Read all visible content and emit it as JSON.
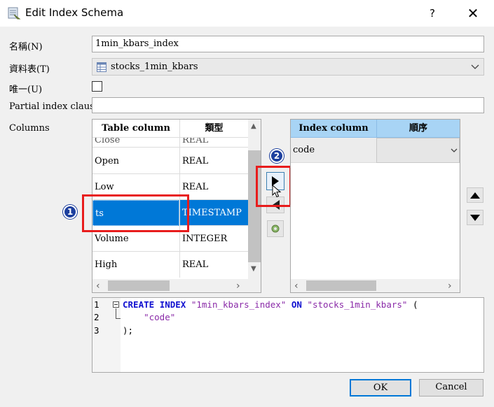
{
  "window": {
    "title": "Edit Index Schema",
    "help": "?",
    "close": "✕"
  },
  "form": {
    "name_label": "名稱(N)",
    "name_value": "1min_kbars_index",
    "table_label": "資料表(T)",
    "table_value": "stocks_1min_kbars",
    "unique_label": "唯一(U)",
    "partial_label": "Partial index clause",
    "partial_value": "",
    "columns_label": "Columns"
  },
  "table_columns": {
    "headers": [
      "Table column",
      "類型"
    ],
    "partial_row": [
      "Close",
      "REAL"
    ],
    "rows": [
      {
        "name": "Open",
        "type": "REAL"
      },
      {
        "name": "Low",
        "type": "REAL"
      },
      {
        "name": "ts",
        "type": "TIMESTAMP"
      },
      {
        "name": "Volume",
        "type": "INTEGER"
      },
      {
        "name": "High",
        "type": "REAL"
      }
    ]
  },
  "index_columns": {
    "headers": [
      "Index column",
      "順序"
    ],
    "rows": [
      {
        "name": "code",
        "order": ""
      }
    ]
  },
  "annotations": {
    "badge1": "1",
    "badge2": "2"
  },
  "sql": {
    "line_numbers": [
      "1",
      "2",
      "3"
    ],
    "line1_kw1": "CREATE",
    "line1_kw2": "INDEX",
    "line1_str1": "\"1min_kbars_index\"",
    "line1_kw3": "ON",
    "line1_str2": "\"stocks_1min_kbars\"",
    "line1_paren": "(",
    "line2_str": "\"code\"",
    "line3": ");"
  },
  "buttons": {
    "ok": "OK",
    "cancel": "Cancel"
  },
  "colors": {
    "selection": "#0078d7",
    "header_blue": "#a8d4f5",
    "annotation_red": "#e81c1c",
    "badge_blue": "#1c3f9e"
  }
}
